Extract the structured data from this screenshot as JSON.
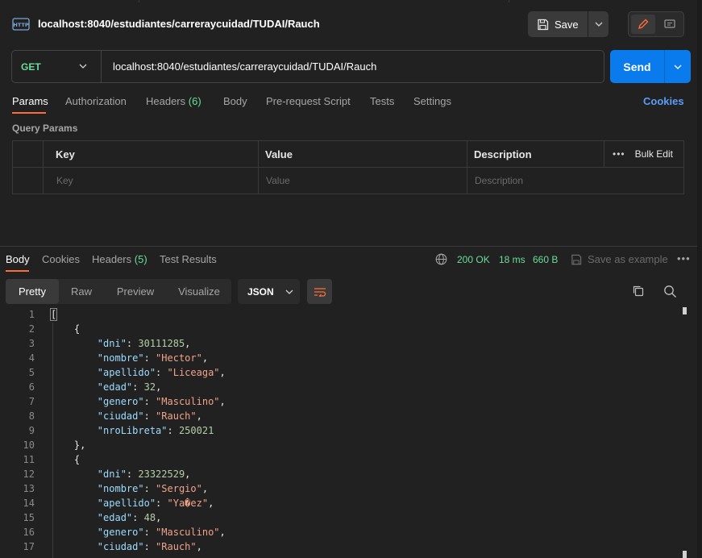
{
  "request": {
    "title": "localhost:8040/estudiantes/carreraycuidad/TUDAI/Rauch",
    "save_label": "Save",
    "method": "GET",
    "url": "localhost:8040/estudiantes/carreraycuidad/TUDAI/Rauch",
    "send_label": "Send"
  },
  "request_tabs": {
    "params": "Params",
    "authorization": "Authorization",
    "headers": "Headers",
    "headers_count": "(6)",
    "body": "Body",
    "prerequest": "Pre-request Script",
    "tests": "Tests",
    "settings": "Settings",
    "cookies": "Cookies"
  },
  "query_params": {
    "label": "Query Params",
    "headers": {
      "key": "Key",
      "value": "Value",
      "description": "Description",
      "bulk_edit": "Bulk Edit"
    },
    "placeholders": {
      "key": "Key",
      "value": "Value",
      "description": "Description"
    }
  },
  "response": {
    "tabs": {
      "body": "Body",
      "cookies": "Cookies",
      "headers": "Headers",
      "headers_count": "(5)",
      "test_results": "Test Results"
    },
    "status": "200 OK",
    "time": "18 ms",
    "size": "660 B",
    "save_example": "Save as example",
    "views": {
      "pretty": "Pretty",
      "raw": "Raw",
      "preview": "Preview",
      "visualize": "Visualize"
    },
    "format": "JSON"
  },
  "code_lines": [
    "[",
    "    {",
    "        \"dni\": 30111285,",
    "        \"nombre\": \"Hector\",",
    "        \"apellido\": \"Liceaga\",",
    "        \"edad\": 32,",
    "        \"genero\": \"Masculino\",",
    "        \"ciudad\": \"Rauch\",",
    "        \"nroLibreta\": 250021",
    "    },",
    "    {",
    "        \"dni\": 23322529,",
    "        \"nombre\": \"Sergio\",",
    "        \"apellido\": \"Ya�ez\",",
    "        \"edad\": 48,",
    "        \"genero\": \"Masculino\",",
    "        \"ciudad\": \"Rauch\","
  ],
  "colors": {
    "accent": "#ff6c37",
    "send": "#097bed",
    "success": "#6bdd9a",
    "link": "#5a9ef7"
  }
}
